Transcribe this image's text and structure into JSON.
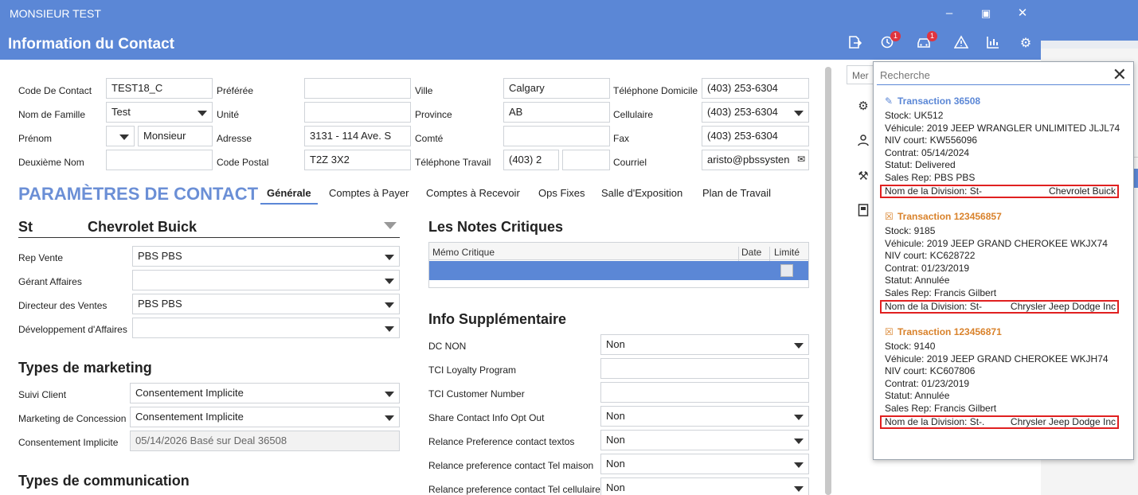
{
  "window": {
    "title": "MONSIEUR TEST",
    "minimize_icon": "minimize-icon",
    "maximize_icon": "maximize-icon",
    "close_icon": "close-icon"
  },
  "header": {
    "title": "Information du Contact",
    "icons": [
      {
        "name": "export-icon",
        "badge": ""
      },
      {
        "name": "history-icon",
        "badge": "1"
      },
      {
        "name": "car-icon",
        "badge": "1"
      },
      {
        "name": "warning-icon",
        "badge": ""
      },
      {
        "name": "chart-icon",
        "badge": ""
      },
      {
        "name": "settings-icon",
        "badge": ""
      }
    ]
  },
  "contact": {
    "code_label": "Code De Contact",
    "code_value": "TEST18_C",
    "nom_label": "Nom de Famille",
    "nom_value": "Test",
    "prenom_label": "Prénom",
    "prenom_value": "Monsieur",
    "deuxieme_label": "Deuxième Nom",
    "deuxieme_value": "",
    "preferee_label": "Préférée",
    "preferee_value": "",
    "unite_label": "Unité",
    "unite_value": "",
    "adresse_label": "Adresse",
    "adresse_value": "3131 - 114 Ave. S",
    "postal_label": "Code Postal",
    "postal_value": "T2Z 3X2",
    "ville_label": "Ville",
    "ville_value": "Calgary",
    "province_label": "Province",
    "province_value": "AB",
    "comte_label": "Comté",
    "comte_value": "",
    "teltravail_label": "Téléphone Travail",
    "teltravail_value": "(403) 2",
    "teltravail_ext": "",
    "teldomicile_label": "Téléphone Domicile",
    "teldomicile_value": "(403) 253-6304",
    "cellulaire_label": "Cellulaire",
    "cellulaire_value": "(403) 253-6304",
    "fax_label": "Fax",
    "fax_value": "(403) 253-6304",
    "courriel_label": "Courriel",
    "courriel_value": "aristo@pbssysten"
  },
  "params": {
    "title": "PARAMÈTRES DE CONTACT",
    "tabs": [
      "Générale",
      "Comptes à Payer",
      "Comptes à Recevoir",
      "Ops Fixes",
      "Salle d'Exposition",
      "Plan de Travail"
    ]
  },
  "store": {
    "code": "St",
    "name": "Chevrolet Buick"
  },
  "reps": [
    {
      "label": "Rep Vente",
      "value": "PBS PBS"
    },
    {
      "label": "Gérant Affaires",
      "value": ""
    },
    {
      "label": "Directeur des Ventes",
      "value": "PBS PBS"
    },
    {
      "label": "Développement d'Affaires",
      "value": ""
    }
  ],
  "marketing": {
    "title": "Types de marketing",
    "suivi_label": "Suivi Client",
    "suivi_value": "Consentement Implicite",
    "concession_label": "Marketing de Concession",
    "concession_value": "Consentement Implicite",
    "implicite_label": "Consentement Implicite",
    "implicite_value": "05/14/2026 Basé sur Deal 36508"
  },
  "communication": {
    "title": "Types de communication"
  },
  "notes": {
    "title": "Les Notes Critiques",
    "col_memo": "Mémo Critique",
    "col_date": "Date",
    "col_limite": "Limité"
  },
  "info": {
    "title": "Info Supplémentaire",
    "rows": [
      {
        "label": "DC NON",
        "value": "Non",
        "dropdown": true
      },
      {
        "label": "TCI Loyalty Program",
        "value": "",
        "dropdown": false
      },
      {
        "label": "TCI Customer Number",
        "value": "",
        "dropdown": false
      },
      {
        "label": "Share Contact Info Opt Out",
        "value": "Non",
        "dropdown": true
      },
      {
        "label": "Relance Preference contact textos",
        "value": "Non",
        "dropdown": true
      },
      {
        "label": "Relance preference contact Tel maison",
        "value": "Non",
        "dropdown": true
      },
      {
        "label": "Relance preference contact Tel cellulaire",
        "value": "Non",
        "dropdown": true
      }
    ]
  },
  "side": {
    "box_text": "Mer"
  },
  "popup": {
    "search_placeholder": "Recherche",
    "transactions": [
      {
        "title": "Transaction 36508",
        "icon": "pencil-icon",
        "color": "blue",
        "stock": "Stock: UK512",
        "vehicule": "Véhicule: 2019 JEEP WRANGLER UNLIMITED JLJL74",
        "niv": "NIV court: KW556096",
        "contrat": "Contrat: 05/14/2024",
        "statut": "Statut: Delivered",
        "rep": "Sales Rep: PBS PBS",
        "division_label": "Nom de la Division: St-",
        "division_value": "Chevrolet Buick"
      },
      {
        "title": "Transaction 123456857",
        "icon": "document-x-icon",
        "color": "orange",
        "stock": "Stock: 9185",
        "vehicule": "Véhicule: 2019 JEEP GRAND CHEROKEE WKJX74",
        "niv": "NIV court: KC628722",
        "contrat": "Contrat: 01/23/2019",
        "statut": "Statut: Annulée",
        "rep": "Sales Rep: Francis Gilbert",
        "division_label": "Nom de la Division: St-",
        "division_value": "Chrysler Jeep Dodge Inc"
      },
      {
        "title": "Transaction 123456871",
        "icon": "document-x-icon",
        "color": "orange",
        "stock": "Stock: 9140",
        "vehicule": "Véhicule: 2019 JEEP GRAND CHEROKEE WKJH74",
        "niv": "NIV court: KC607806",
        "contrat": "Contrat: 01/23/2019",
        "statut": "Statut: Annulée",
        "rep": "Sales Rep: Francis Gilbert",
        "division_label": "Nom de la Division: St-.",
        "division_value": "Chrysler Jeep Dodge Inc"
      }
    ]
  }
}
